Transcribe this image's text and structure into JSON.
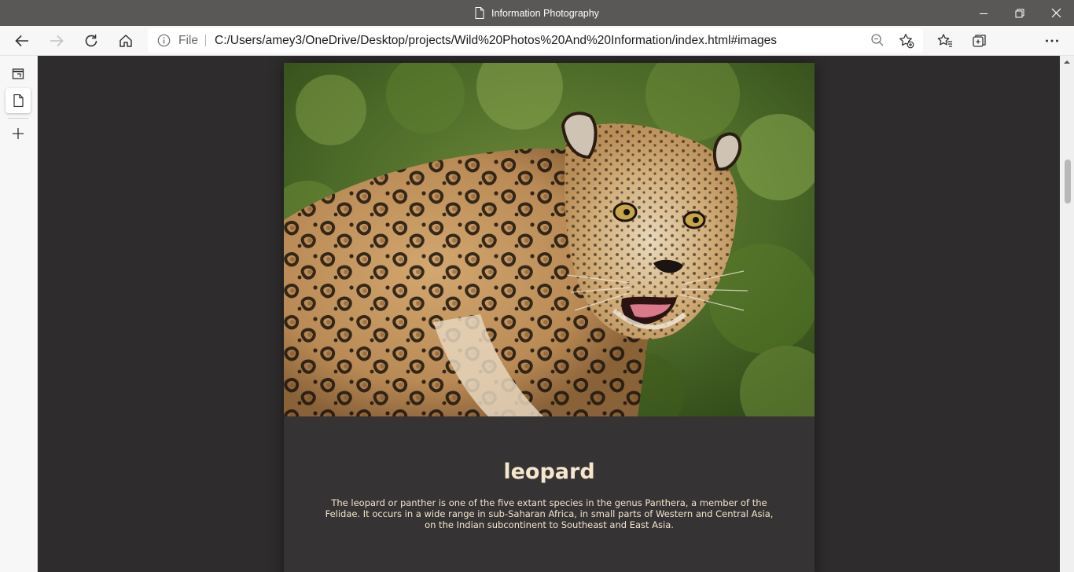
{
  "window": {
    "title": "Information Photography"
  },
  "toolbar": {
    "address_prefix": "File",
    "url": "C:/Users/amey3/OneDrive/Desktop/projects/Wild%20Photos%20And%20Information/index.html#images"
  },
  "article": {
    "heading": "leopard",
    "description": "The leopard or panther is one of the five extant species in the genus Panthera, a member of the Felidae. It occurs in a wide range in sub-Saharan Africa, in small parts of Western and Central Asia, on the Indian subcontinent to Southeast and East Asia."
  },
  "colors": {
    "page_background": "#2e2c2c",
    "card_background": "#363334",
    "text": "#f5e6cc",
    "titlebar": "#5a5856"
  },
  "scroll": {
    "position_fraction": 0.15
  }
}
